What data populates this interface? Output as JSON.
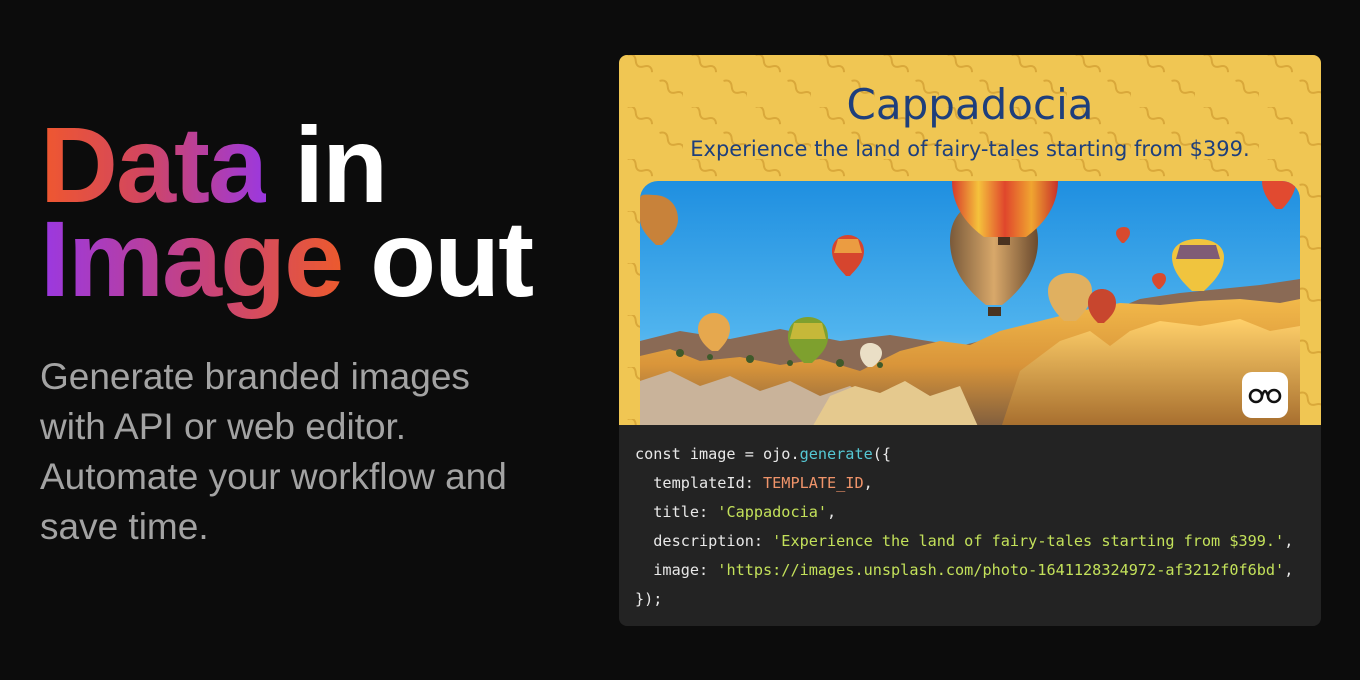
{
  "hero": {
    "headline": {
      "line1_highlight": "Data",
      "line1_rest": " in",
      "line2_highlight": "Image",
      "line2_rest": " out"
    },
    "subtitle": "Generate branded images with API or web editor. Automate your workflow and save time.",
    "gradient_colors": [
      "#f0582e",
      "#d2465f",
      "#9b38e0"
    ]
  },
  "preview": {
    "title": "Cappadocia",
    "description": "Experience the land of fairy-tales starting from $399.",
    "background_color": "#f0c653",
    "text_color": "#1e3f7c",
    "logo_icon": "ojo-logo-icon"
  },
  "code": {
    "line1": {
      "kw": "const",
      "var": " image = ojo.",
      "fn": "generate",
      "open": "({"
    },
    "line2": {
      "key": "  templateId: ",
      "value": "TEMPLATE_ID",
      "end": ","
    },
    "line3": {
      "key": "  title: ",
      "value": "'Cappadocia'",
      "end": ","
    },
    "line4": {
      "key": "  description: ",
      "value": "'Experience the land of fairy-tales starting from $399.'",
      "end": ","
    },
    "line5": {
      "key": "  image: ",
      "value": "'https://images.unsplash.com/photo-1641128324972-af3212f0f6bd'",
      "end": ","
    },
    "line6": {
      "close": "});"
    }
  }
}
